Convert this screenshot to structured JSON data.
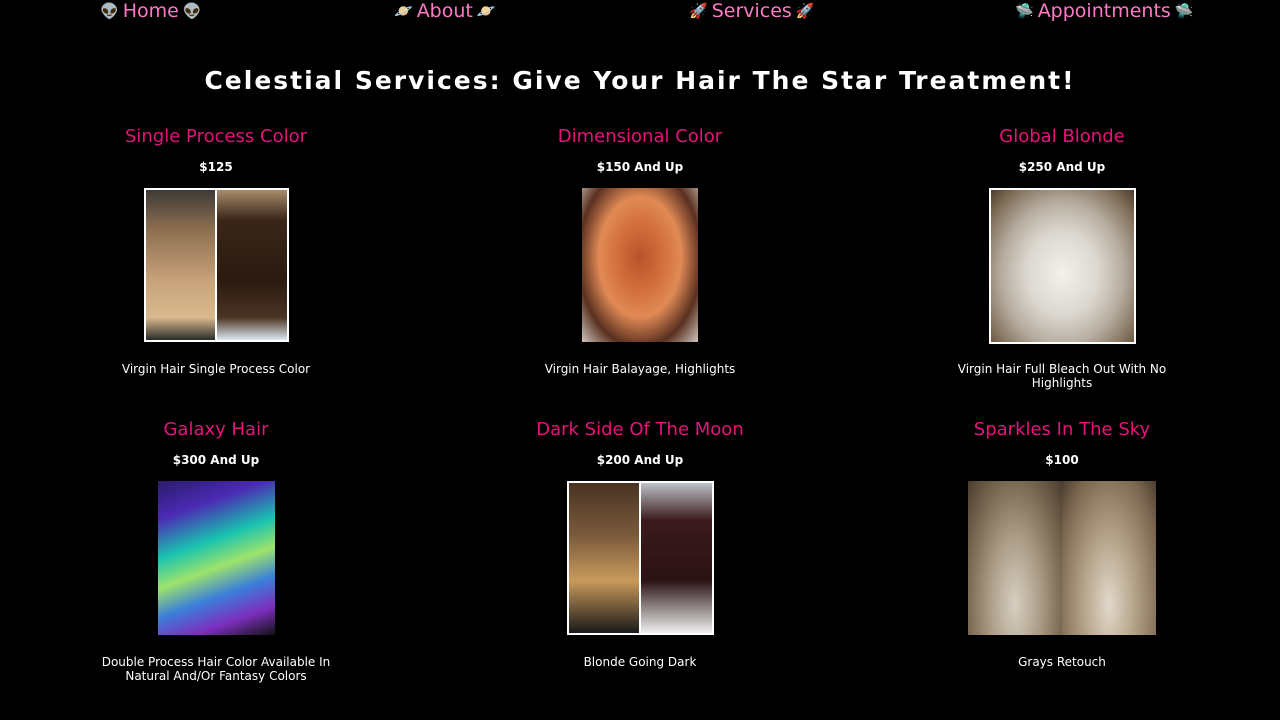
{
  "nav": {
    "home": {
      "label": "Home",
      "emoji": "👽"
    },
    "about": {
      "label": "About",
      "emoji": "🪐"
    },
    "services": {
      "label": "Services",
      "emoji": "🚀"
    },
    "appointments": {
      "label": "Appointments",
      "emoji": "🛸"
    }
  },
  "page_title": "Celestial Services: Give Your Hair The Star Treatment!",
  "services": [
    {
      "name": "Single Process Color",
      "price": "$125",
      "description": "Virgin Hair Single Process Color",
      "image": "before-after-brown-hair-photo"
    },
    {
      "name": "Dimensional Color",
      "price": "$150 And Up",
      "description": "Virgin Hair Balayage, Highlights",
      "image": "copper-balayage-photo"
    },
    {
      "name": "Global Blonde",
      "price": "$250 And Up",
      "description": "Virgin Hair Full Bleach Out With No Highlights",
      "image": "platinum-blonde-photo"
    },
    {
      "name": "Galaxy Hair",
      "price": "$300 And Up",
      "description": "Double Process Hair Color Available In Natural And/Or Fantasy Colors",
      "image": "rainbow-galaxy-hair-photo"
    },
    {
      "name": "Dark Side Of The Moon",
      "price": "$200 And Up",
      "description": "Blonde Going Dark",
      "image": "blonde-to-dark-photo"
    },
    {
      "name": "Sparkles In The Sky",
      "price": "$100",
      "description": "Grays Retouch",
      "image": "gray-roots-retouch-photo"
    }
  ]
}
